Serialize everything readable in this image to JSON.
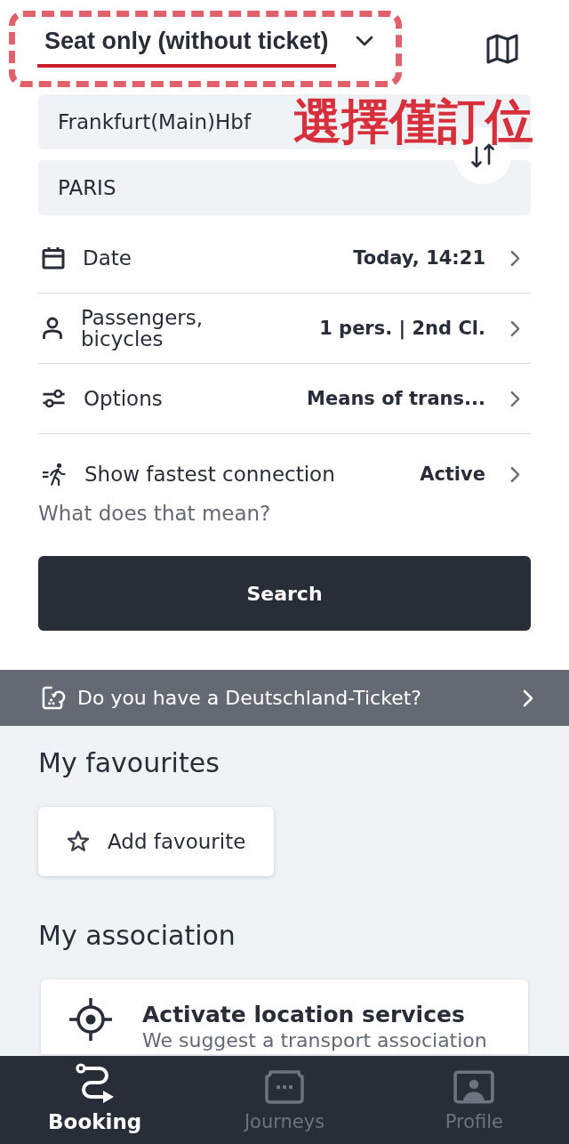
{
  "booking_mode": {
    "label": "Seat only (without ticket)"
  },
  "annotation": {
    "text": "選擇僅訂位"
  },
  "route": {
    "from": "Frankfurt(Main)Hbf",
    "to": "PARIS"
  },
  "search_options": [
    {
      "kind": "date",
      "label": "Date",
      "value": "Today, 14:21"
    },
    {
      "kind": "passengers",
      "label": "Passengers, bicycles",
      "value": "1 pers. | 2nd Cl."
    },
    {
      "kind": "options",
      "label": "Options",
      "value": "Means of trans..."
    },
    {
      "kind": "fastest",
      "label": "Show fastest connection",
      "value": "Active"
    }
  ],
  "help_link": "What does that mean?",
  "search_button": {
    "label": "Search"
  },
  "ticket_banner": {
    "text": "Do you have a Deutschland-Ticket?"
  },
  "favourites": {
    "heading": "My favourites",
    "add_button": "Add favourite"
  },
  "association": {
    "heading": "My association",
    "card": {
      "title": "Activate location services",
      "text": "We suggest a transport association"
    }
  },
  "bottom_nav": [
    {
      "kind": "booking",
      "label": "Booking",
      "selected": true
    },
    {
      "kind": "journeys",
      "label": "Journeys",
      "selected": false
    },
    {
      "kind": "profile",
      "label": "Profile",
      "selected": false
    }
  ]
}
